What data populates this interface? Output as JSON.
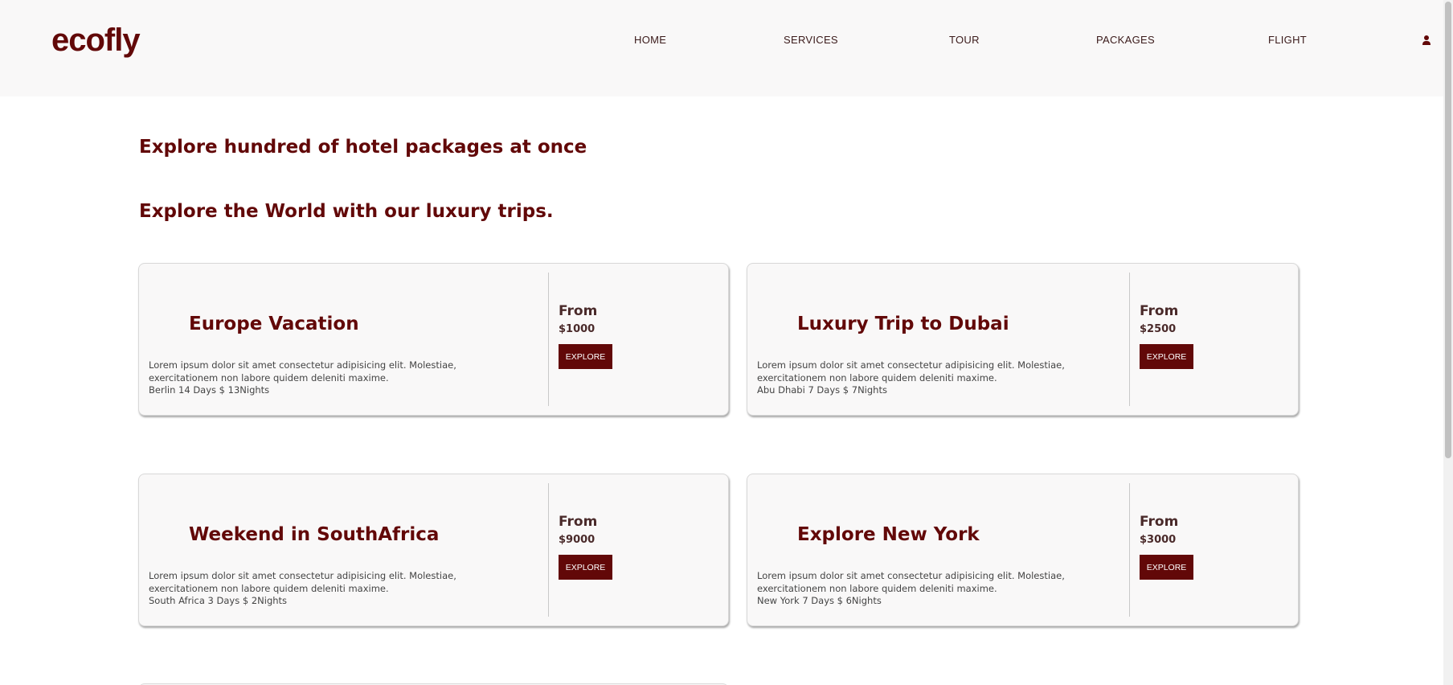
{
  "header": {
    "logo": "ecofly",
    "nav": [
      {
        "label": "HOME"
      },
      {
        "label": "SERVICES"
      },
      {
        "label": "TOUR"
      },
      {
        "label": "PACKAGES"
      },
      {
        "label": "FLIGHT"
      }
    ],
    "user_icon": "user-icon"
  },
  "main": {
    "heading1": "Explore hundred of hotel packages at once",
    "heading2": "Explore the World with our luxury trips.",
    "cards": [
      {
        "title": "Europe Vacation",
        "description": "Lorem ipsum dolor sit amet consectetur adipisicing elit. Molestiae, exercitationem non labore quidem deleniti maxime.",
        "meta": "Berlin 14 Days $ 13Nights",
        "from_label": "From",
        "price": "$1000",
        "button": "EXPLORE"
      },
      {
        "title": "Luxury Trip to Dubai",
        "description": "Lorem ipsum dolor sit amet consectetur adipisicing elit. Molestiae, exercitationem non labore quidem deleniti maxime.",
        "meta": "Abu Dhabi 7 Days $ 7Nights",
        "from_label": "From",
        "price": "$2500",
        "button": "EXPLORE"
      },
      {
        "title": "Weekend in SouthAfrica",
        "description": "Lorem ipsum dolor sit amet consectetur adipisicing elit. Molestiae, exercitationem non labore quidem deleniti maxime.",
        "meta": "South Africa 3 Days $ 2Nights",
        "from_label": "From",
        "price": "$9000",
        "button": "EXPLORE"
      },
      {
        "title": "Explore New York",
        "description": "Lorem ipsum dolor sit amet consectetur adipisicing elit. Molestiae, exercitationem non labore quidem deleniti maxime.",
        "meta": "New York 7 Days $ 6Nights",
        "from_label": "From",
        "price": "$3000",
        "button": "EXPLORE"
      }
    ]
  },
  "colors": {
    "brand": "#620808",
    "header_bg": "#f9f8f8",
    "card_bg": "#f9f8f8"
  }
}
